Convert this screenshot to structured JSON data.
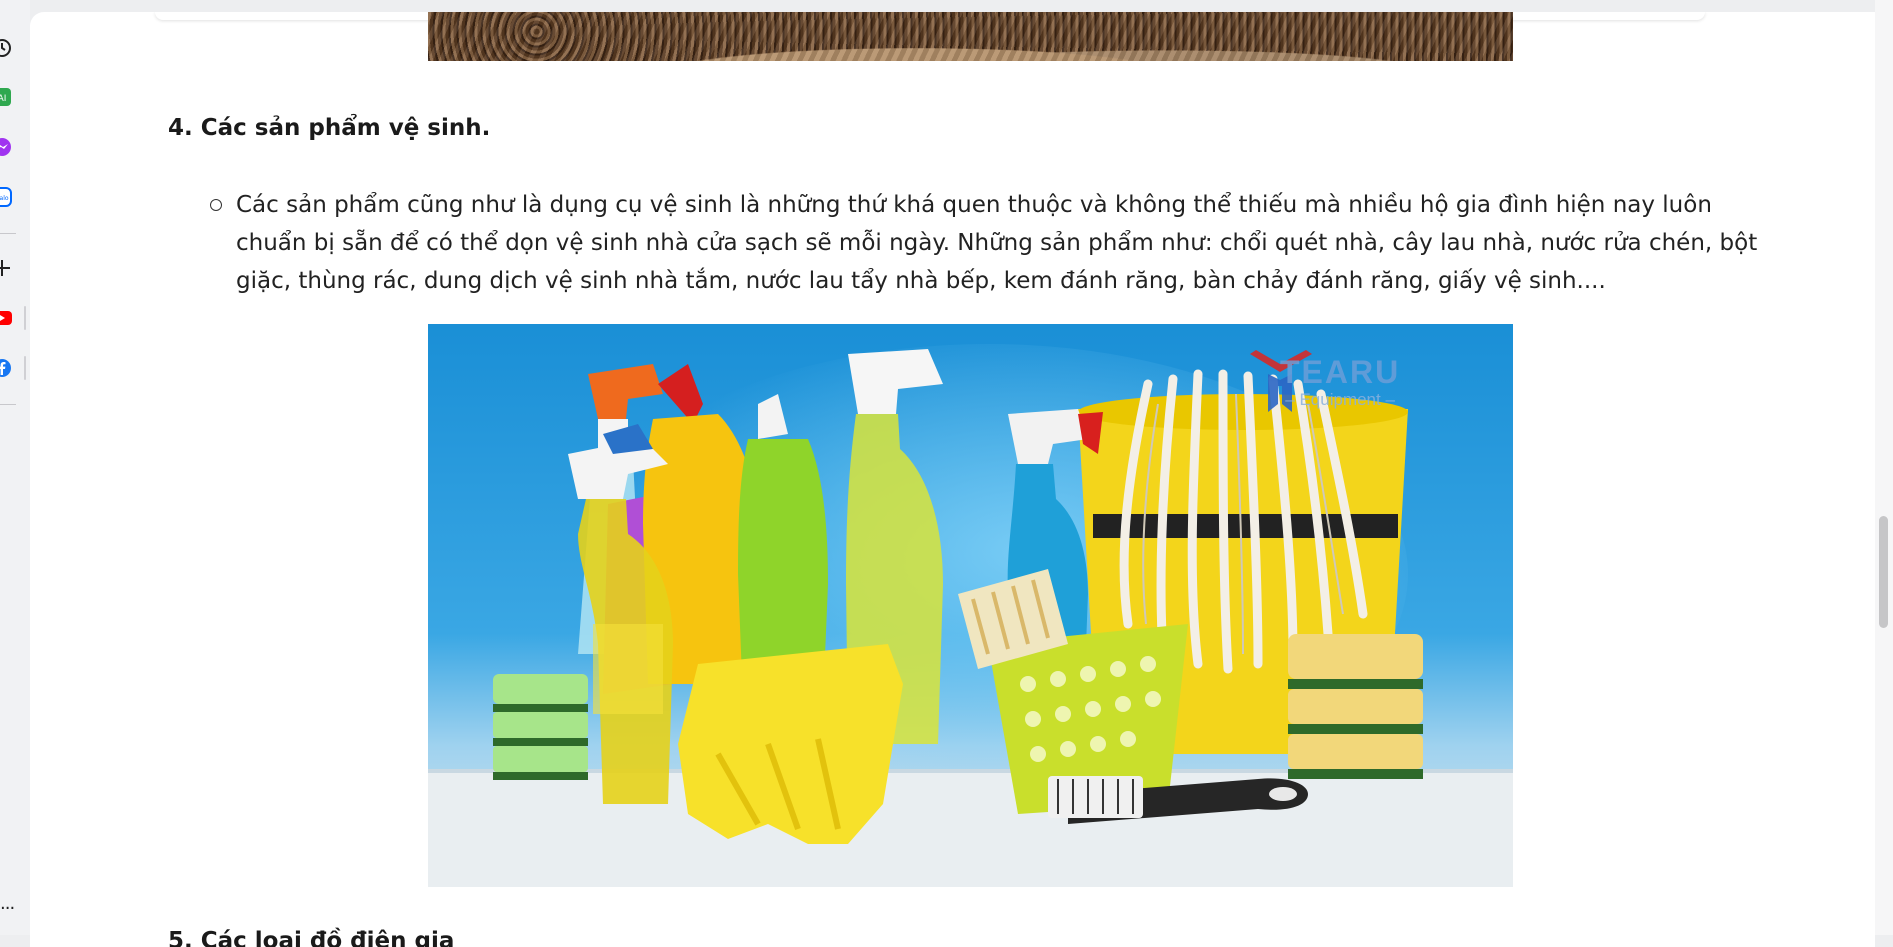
{
  "browser": {
    "sidebar_icons": [
      "clock-icon",
      "ai-app-icon",
      "messenger-icon",
      "zalo-icon",
      "add-icon",
      "youtube-icon",
      "facebook-icon",
      "more-icon"
    ],
    "more_label": "...",
    "colors": {
      "youtube": "#ff0000",
      "facebook": "#1877f2",
      "messenger": "#a034f0",
      "zalo": "#0068ff",
      "ai_app": "#2fa84f"
    }
  },
  "article": {
    "section_4_heading": "4. Các sản phẩm vệ sinh.",
    "section_4_bullet": "Các sản phẩm cũng như là dụng cụ vệ sinh là những thứ khá quen thuộc và không thể thiếu mà nhiều hộ gia đình hiện nay luôn chuẩn bị sẵn để có thể dọn vệ sinh nhà cửa sạch sẽ mỗi ngày. Những sản phẩm như: chổi quét nhà, cây lau nhà, nước rửa chén, bột giặc, thùng rác, dung dịch vệ sinh nhà tắm, nước lau tẩy nhà bếp, kem đánh răng, bàn chảy đánh răng, giấy vệ sinh....",
    "watermark_brand": "TEARU",
    "watermark_sub": "– Equipment –",
    "section_5_heading_partial": "5. Các loại đồ điện gia"
  },
  "scroll": {
    "position": 0.55
  }
}
